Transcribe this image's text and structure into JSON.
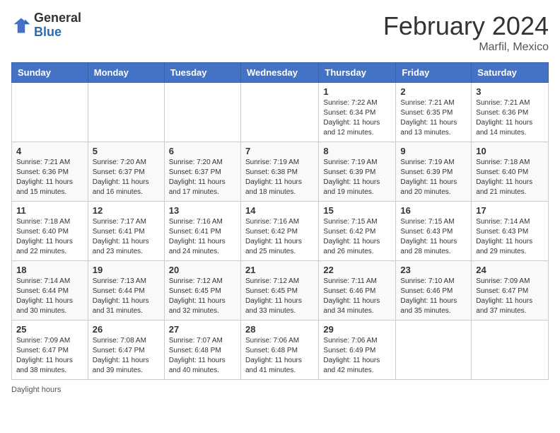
{
  "header": {
    "logo_general": "General",
    "logo_blue": "Blue",
    "main_title": "February 2024",
    "subtitle": "Marfil, Mexico"
  },
  "footer": {
    "daylight_label": "Daylight hours"
  },
  "columns": [
    "Sunday",
    "Monday",
    "Tuesday",
    "Wednesday",
    "Thursday",
    "Friday",
    "Saturday"
  ],
  "weeks": [
    [
      {
        "day": "",
        "info": ""
      },
      {
        "day": "",
        "info": ""
      },
      {
        "day": "",
        "info": ""
      },
      {
        "day": "",
        "info": ""
      },
      {
        "day": "1",
        "info": "Sunrise: 7:22 AM\nSunset: 6:34 PM\nDaylight: 11 hours\nand 12 minutes."
      },
      {
        "day": "2",
        "info": "Sunrise: 7:21 AM\nSunset: 6:35 PM\nDaylight: 11 hours\nand 13 minutes."
      },
      {
        "day": "3",
        "info": "Sunrise: 7:21 AM\nSunset: 6:36 PM\nDaylight: 11 hours\nand 14 minutes."
      }
    ],
    [
      {
        "day": "4",
        "info": "Sunrise: 7:21 AM\nSunset: 6:36 PM\nDaylight: 11 hours\nand 15 minutes."
      },
      {
        "day": "5",
        "info": "Sunrise: 7:20 AM\nSunset: 6:37 PM\nDaylight: 11 hours\nand 16 minutes."
      },
      {
        "day": "6",
        "info": "Sunrise: 7:20 AM\nSunset: 6:37 PM\nDaylight: 11 hours\nand 17 minutes."
      },
      {
        "day": "7",
        "info": "Sunrise: 7:19 AM\nSunset: 6:38 PM\nDaylight: 11 hours\nand 18 minutes."
      },
      {
        "day": "8",
        "info": "Sunrise: 7:19 AM\nSunset: 6:39 PM\nDaylight: 11 hours\nand 19 minutes."
      },
      {
        "day": "9",
        "info": "Sunrise: 7:19 AM\nSunset: 6:39 PM\nDaylight: 11 hours\nand 20 minutes."
      },
      {
        "day": "10",
        "info": "Sunrise: 7:18 AM\nSunset: 6:40 PM\nDaylight: 11 hours\nand 21 minutes."
      }
    ],
    [
      {
        "day": "11",
        "info": "Sunrise: 7:18 AM\nSunset: 6:40 PM\nDaylight: 11 hours\nand 22 minutes."
      },
      {
        "day": "12",
        "info": "Sunrise: 7:17 AM\nSunset: 6:41 PM\nDaylight: 11 hours\nand 23 minutes."
      },
      {
        "day": "13",
        "info": "Sunrise: 7:16 AM\nSunset: 6:41 PM\nDaylight: 11 hours\nand 24 minutes."
      },
      {
        "day": "14",
        "info": "Sunrise: 7:16 AM\nSunset: 6:42 PM\nDaylight: 11 hours\nand 25 minutes."
      },
      {
        "day": "15",
        "info": "Sunrise: 7:15 AM\nSunset: 6:42 PM\nDaylight: 11 hours\nand 26 minutes."
      },
      {
        "day": "16",
        "info": "Sunrise: 7:15 AM\nSunset: 6:43 PM\nDaylight: 11 hours\nand 28 minutes."
      },
      {
        "day": "17",
        "info": "Sunrise: 7:14 AM\nSunset: 6:43 PM\nDaylight: 11 hours\nand 29 minutes."
      }
    ],
    [
      {
        "day": "18",
        "info": "Sunrise: 7:14 AM\nSunset: 6:44 PM\nDaylight: 11 hours\nand 30 minutes."
      },
      {
        "day": "19",
        "info": "Sunrise: 7:13 AM\nSunset: 6:44 PM\nDaylight: 11 hours\nand 31 minutes."
      },
      {
        "day": "20",
        "info": "Sunrise: 7:12 AM\nSunset: 6:45 PM\nDaylight: 11 hours\nand 32 minutes."
      },
      {
        "day": "21",
        "info": "Sunrise: 7:12 AM\nSunset: 6:45 PM\nDaylight: 11 hours\nand 33 minutes."
      },
      {
        "day": "22",
        "info": "Sunrise: 7:11 AM\nSunset: 6:46 PM\nDaylight: 11 hours\nand 34 minutes."
      },
      {
        "day": "23",
        "info": "Sunrise: 7:10 AM\nSunset: 6:46 PM\nDaylight: 11 hours\nand 35 minutes."
      },
      {
        "day": "24",
        "info": "Sunrise: 7:09 AM\nSunset: 6:47 PM\nDaylight: 11 hours\nand 37 minutes."
      }
    ],
    [
      {
        "day": "25",
        "info": "Sunrise: 7:09 AM\nSunset: 6:47 PM\nDaylight: 11 hours\nand 38 minutes."
      },
      {
        "day": "26",
        "info": "Sunrise: 7:08 AM\nSunset: 6:47 PM\nDaylight: 11 hours\nand 39 minutes."
      },
      {
        "day": "27",
        "info": "Sunrise: 7:07 AM\nSunset: 6:48 PM\nDaylight: 11 hours\nand 40 minutes."
      },
      {
        "day": "28",
        "info": "Sunrise: 7:06 AM\nSunset: 6:48 PM\nDaylight: 11 hours\nand 41 minutes."
      },
      {
        "day": "29",
        "info": "Sunrise: 7:06 AM\nSunset: 6:49 PM\nDaylight: 11 hours\nand 42 minutes."
      },
      {
        "day": "",
        "info": ""
      },
      {
        "day": "",
        "info": ""
      }
    ]
  ]
}
